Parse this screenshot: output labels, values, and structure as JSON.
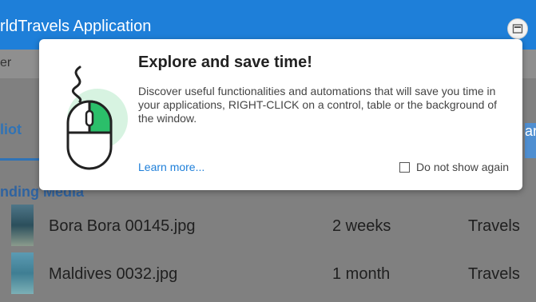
{
  "app": {
    "title": "rldTravels Application",
    "menubar": {
      "first_label": "er"
    },
    "tabs": {
      "left_label": "liot",
      "right_label": "ar"
    },
    "section_title": "nding Media",
    "rows": [
      {
        "name": "Bora Bora 00145.jpg",
        "age": "2 weeks",
        "category": "Travels"
      },
      {
        "name": "Maldives 0032.jpg",
        "age": "1 month",
        "category": "Travels"
      }
    ]
  },
  "popup": {
    "heading": "Explore and save time!",
    "body": "Discover useful functionalities and automations that will save you time in your applications, RIGHT-CLICK on a control, table or the background of the window.",
    "learn_more": "Learn more...",
    "do_not_show": "Do not show again",
    "checkbox_checked": false,
    "icon": "mouse-right-click-icon",
    "accent_color": "#2bbf6a"
  },
  "colors": {
    "titlebar": "#1e7fd9",
    "link": "#1e7fd9"
  }
}
